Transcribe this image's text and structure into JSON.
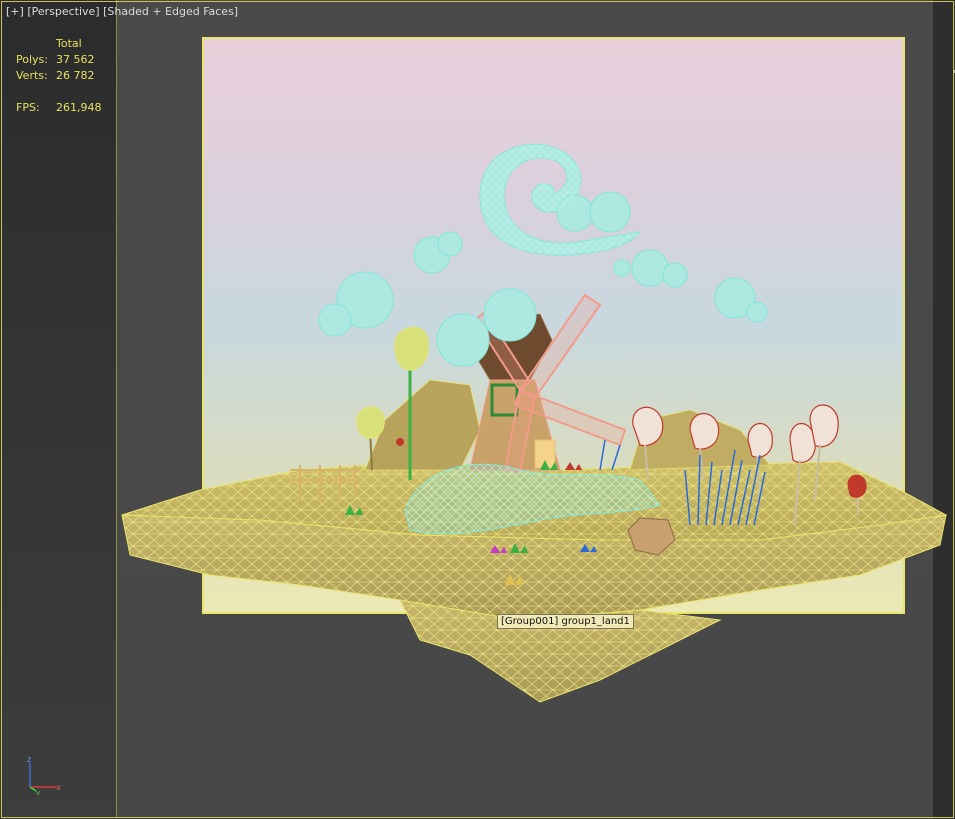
{
  "viewport": {
    "label_parts": [
      "[+]",
      "[Perspective]",
      "[Shaded + Edged Faces]"
    ]
  },
  "stats": {
    "header": "Total",
    "polys_label": "Polys:",
    "polys_value": "37 562",
    "verts_label": "Verts:",
    "verts_value": "26 782",
    "fps_label": "FPS:",
    "fps_value": "261,948"
  },
  "tooltip": {
    "text": "[Group001] group1_land1"
  },
  "gizmo": {
    "z_label": "z",
    "x_label": "x",
    "y_label": "y"
  },
  "colors": {
    "selection_wire": "#e8e36a",
    "cloud_wire": "#7fe8d8",
    "windmill_wire": "#f29b8a",
    "plants_wire": "#2a6bd8",
    "trees_wire": "#c0392b",
    "leaf_green": "#3cb043"
  }
}
